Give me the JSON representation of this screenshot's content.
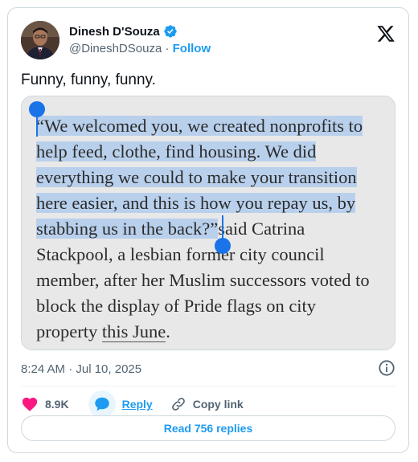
{
  "author": {
    "name": "Dinesh D'Souza",
    "handle": "@DineshDSouza",
    "separator": "·",
    "follow_label": "Follow",
    "verified_color": "#1d9bf0"
  },
  "tweet": {
    "text": "Funny, funny, funny.",
    "timestamp": "8:24 AM · Jul 10, 2025"
  },
  "media": {
    "lines": [
      "“We welcomed you, we created nonprofits to",
      "help feed, clothe, find housing. We did",
      "everything we could to make your transition",
      "here easier, and this is how you repay us, by",
      "stabbing us in the back?”",
      "said Catrina",
      "Stackpool, a lesbian former city council",
      "member, after her Muslim successors voted to",
      "block the display of Pride flags on city",
      "property ",
      "this June",
      "."
    ],
    "highlight_color": "#b9d0ec",
    "handle_color": "#1a73e8",
    "background": "#e8e8e8"
  },
  "actions": {
    "likes": "8.9K",
    "reply_label": "Reply",
    "copy_link_label": "Copy link",
    "like_color": "#f91880",
    "accent": "#1d9bf0"
  },
  "footer": {
    "read_replies_label": "Read 756 replies"
  },
  "icons": {
    "brand": "x-logo-icon",
    "verified": "verified-badge-icon",
    "info": "info-icon",
    "like": "heart-icon",
    "reply": "speech-bubble-icon",
    "copy": "link-icon"
  }
}
